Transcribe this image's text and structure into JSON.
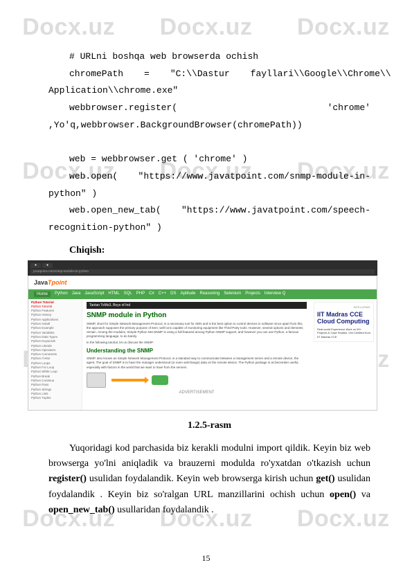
{
  "watermark": "Docx.uz",
  "code": {
    "l1": "# URLni boshqa web browserda ochish",
    "l2": "chromePath = \"C:\\\\Dastur fayllari\\\\Google\\\\Chrome\\\\ Application\\\\chrome.exe\"",
    "l2a": "chromePath",
    "l2b": "=",
    "l2c": "\"C:\\\\Dastur",
    "l2d": "fayllari\\\\Google\\\\Chrome\\\\",
    "l2e": "Application\\\\chrome.exe\"",
    "l3": "webbrowser.register( 'chrome' ,Yo'q,webbrowser.BackgroundBrowser(chromePath))",
    "l5": "web = webbrowser.get ( 'chrome' )",
    "l6": "web.open( \"https://www.javatpoint.com/snmp-module-in-python\" )",
    "l7": "web.open_new_tab( \"https://www.javatpoint.com/speech-recognition-python\" )"
  },
  "heading_output": "Chiqish:",
  "screenshot": {
    "addr": "javatpoint.com/snmp-module-in-python",
    "brand": "Java",
    "brand2": "Tpoint",
    "nav": [
      "Home",
      "Python",
      "Java",
      "JavaScript",
      "HTML",
      "SQL",
      "PHP",
      "C#",
      "C++",
      "DS",
      "Aptitude",
      "Reasoning",
      "Selenium",
      "Projects",
      "Interview Q"
    ],
    "sidebar_head": "Python Tutorial",
    "sidebar": [
      "Python Tutorial",
      "Python Features",
      "Python History",
      "Python Applications",
      "Python Install",
      "Python Example",
      "Python Variables",
      "Python Data Types",
      "Python Keywords",
      "Python Literals",
      "Python Operators",
      "Python Comments",
      "Python If else",
      "Python Loops",
      "Python For Loop",
      "Python While Loop",
      "Python Break",
      "Python Continue",
      "Python Pass",
      "Python Strings",
      "Python Lists",
      "Python Tuples"
    ],
    "ad_top": "Tantan ToMo3, Boys of Ind",
    "h1": "SNMP module in Python",
    "p1": "SNMP, short for Simple Network Management Protocol, is a necessary tool for SDN and is the best option to control devices in software since apart from this, the approach supposes the primary purpose of item; well tons capable of monitoring equipment like Third-Party tools. However, several options and elements remain. Among the modules, Simple Python Net-SNMP is using a full-featured among Python SNMP support, and however you can use Python, a famous programming language, to do barely.",
    "p1_note": "In the following tutorial, let us discuss the SNMP.",
    "h2": "Understanding the SNMP",
    "p2": "SNMP, also known as Simple Network Management Protocol, is a standard way to communicate between a management server and a remote device, the agent. The goal of SNMP is to have the manager understood (or even set/change) data on the remote device. The Python package is at December useful, especially with factors in the world that we want to have from the servers.",
    "ad_side_brand": "INTELLIPAAT",
    "ad_side_head": "IIT Madras CCE Cloud Computing",
    "ad_side_sub": "Real-world Experience Work on 50+ Projects & Case Studies. Get Certified from IIT Madras CCE",
    "ad_label": "ADVERTISEMENT"
  },
  "caption": "1.2.5-rasm",
  "para": {
    "t1": "Yuqoridagi kod parchasida biz kerakli modulni import qildik. Keyin biz web browserga yo'lni aniqladik va brauzerni modulda ro'yxatdan o'tkazish uchun ",
    "b1": "register()",
    "t2": " usulidan foydalandik. Keyin web browserga kirish uchun ",
    "b2": "get()",
    "t3": " usulidan foydalandik . Keyin biz so'ralgan URL manzillarini ochish uchun ",
    "b3": "open()",
    "t4": " va ",
    "b4": "open_new_tab()",
    "t5": " usullaridan foydalandik ."
  },
  "page_num": "15"
}
